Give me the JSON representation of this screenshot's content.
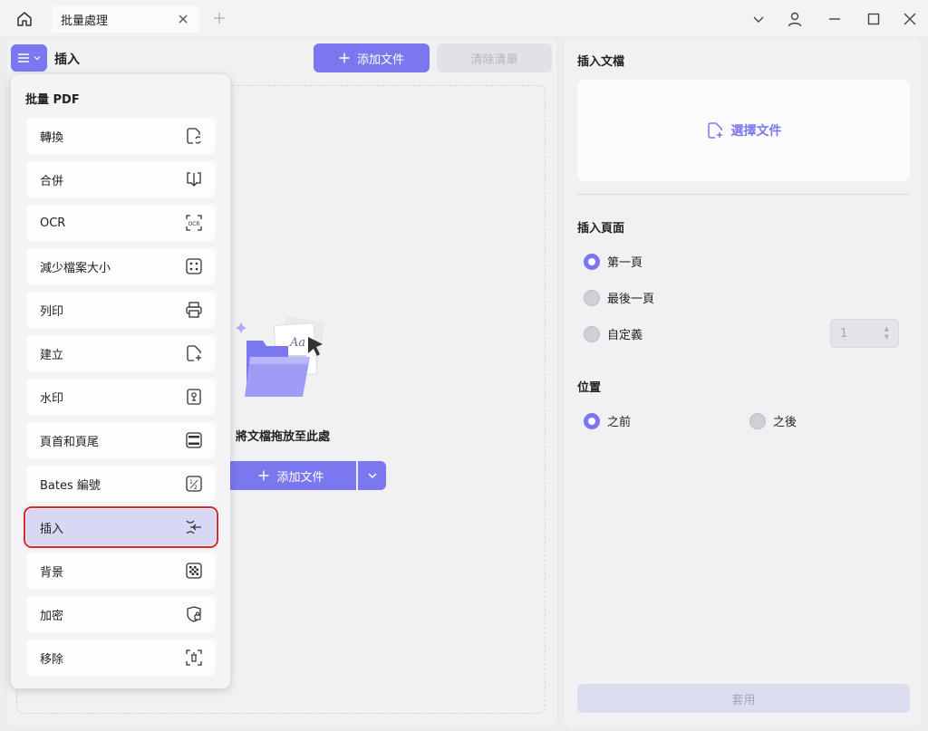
{
  "titlebar": {
    "tab_label": "批量處理"
  },
  "left_panel": {
    "title": "插入",
    "add_files_label": "添加文件",
    "clear_list_label": "清除清單",
    "drop_text": "將文檔拖放至此處",
    "add_files_main_label": "添加文件"
  },
  "dropmenu": {
    "title": "批量 PDF",
    "items": [
      {
        "label": "轉換",
        "icon": "convert-icon"
      },
      {
        "label": "合併",
        "icon": "merge-icon"
      },
      {
        "label": "OCR",
        "icon": "ocr-icon"
      },
      {
        "label": "減少檔案大小",
        "icon": "compress-icon"
      },
      {
        "label": "列印",
        "icon": "printer-icon"
      },
      {
        "label": "建立",
        "icon": "create-icon"
      },
      {
        "label": "水印",
        "icon": "watermark-icon"
      },
      {
        "label": "頁首和頁尾",
        "icon": "header-footer-icon"
      },
      {
        "label": "Bates 編號",
        "icon": "bates-icon"
      },
      {
        "label": "插入",
        "icon": "insert-icon"
      },
      {
        "label": "背景",
        "icon": "background-icon"
      },
      {
        "label": "加密",
        "icon": "encrypt-icon"
      },
      {
        "label": "移除",
        "icon": "remove-icon"
      }
    ],
    "active_index": 9
  },
  "right_panel": {
    "insert_doc_heading": "插入文檔",
    "choose_file_label": "選擇文件",
    "insert_page_heading": "插入頁面",
    "page_options": [
      "第一頁",
      "最後一頁",
      "自定義"
    ],
    "selected_page_option": "第一頁",
    "custom_page_value": "1",
    "position_heading": "位置",
    "position_options": [
      "之前",
      "之後"
    ],
    "selected_position": "之前",
    "apply_label": "套用"
  },
  "colors": {
    "accent": "#7b78ef",
    "highlight_border": "#d9282f"
  }
}
